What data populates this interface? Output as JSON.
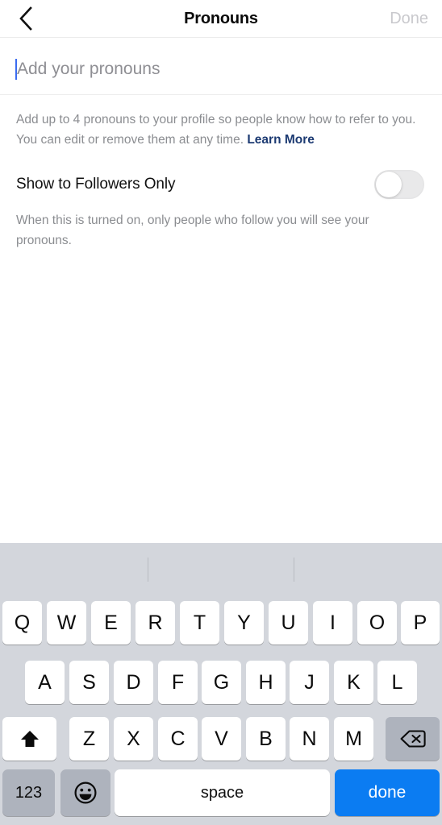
{
  "header": {
    "back_icon": "chevron-left-icon",
    "title": "Pronouns",
    "done_label": "Done"
  },
  "input": {
    "value": "",
    "placeholder": "Add your pronouns"
  },
  "description": {
    "text": "Add up to 4 pronouns to your profile so people know how to refer to you. You can edit or remove them at any time. ",
    "link_label": "Learn More"
  },
  "toggle": {
    "label": "Show to Followers Only",
    "state": "off",
    "helper_text": "When this is turned on, only people who follow you will see your pronouns."
  },
  "keyboard": {
    "suggestions": [
      "",
      "",
      ""
    ],
    "row1": [
      "Q",
      "W",
      "E",
      "R",
      "T",
      "Y",
      "U",
      "I",
      "O",
      "P"
    ],
    "row2": [
      "A",
      "S",
      "D",
      "F",
      "G",
      "H",
      "J",
      "K",
      "L"
    ],
    "row3": [
      "Z",
      "X",
      "C",
      "V",
      "B",
      "N",
      "M"
    ],
    "shift_icon": "shift-up-arrow-icon",
    "backspace_icon": "backspace-delete-icon",
    "numeric_label": "123",
    "emoji_icon": "emoji-smiley-icon",
    "space_label": "space",
    "return_label": "done"
  },
  "colors": {
    "accent_blue": "#0b7cf2",
    "link_navy": "#1c3a72",
    "keyboard_bg": "#d3d6dc",
    "key_white": "#ffffff",
    "key_gray": "#aeb3bd",
    "muted_text": "#8b8d91",
    "disabled_text": "#c9c9cd",
    "caret_blue": "#3b6cf0"
  }
}
